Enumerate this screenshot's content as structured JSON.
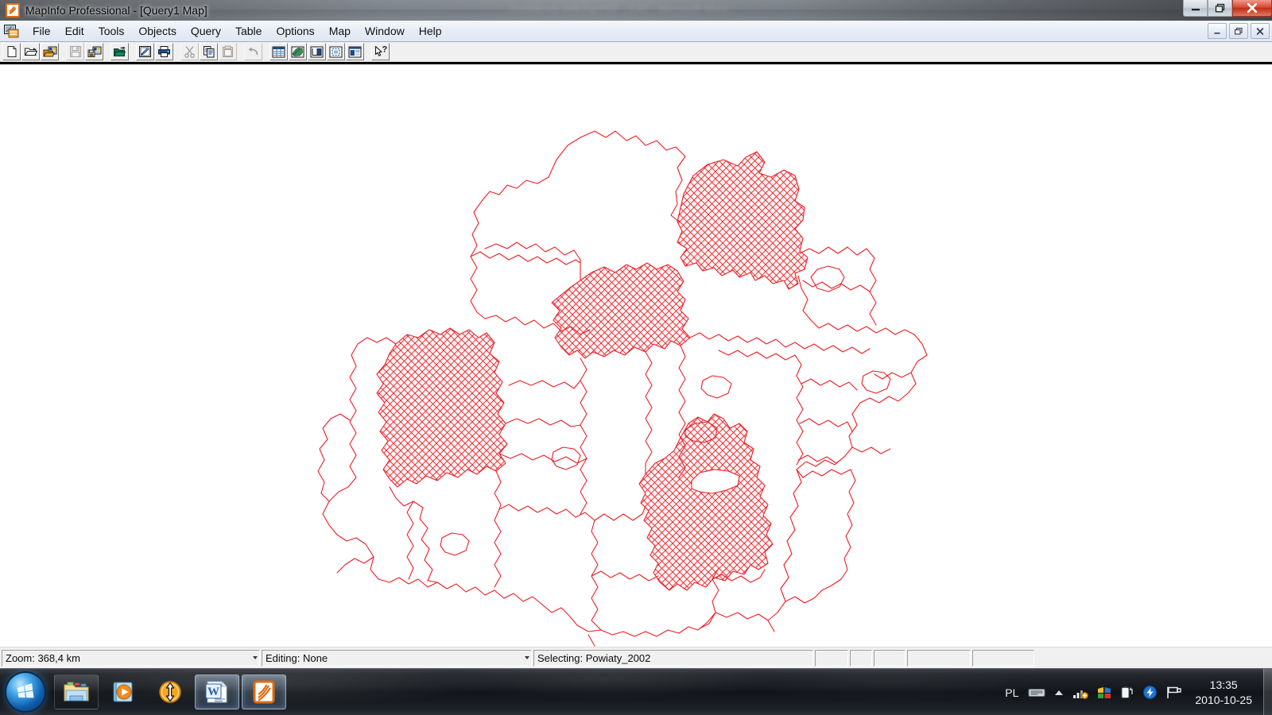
{
  "window": {
    "title": "MapInfo Professional - [Query1 Map]",
    "app_icon": "mapinfo-icon",
    "ghost_title_behind": "Dodatkowy edit.ing.PDF - CAT - Microsoft Word",
    "controls": [
      {
        "name": "minimize-button",
        "glyph": "minimize-icon"
      },
      {
        "name": "restore-button",
        "glyph": "restore-icon"
      },
      {
        "name": "close-button",
        "glyph": "close-icon"
      }
    ],
    "accent_close": "#c8341a"
  },
  "menubar": {
    "mdi_icon": "mapinfo-document-icon",
    "items": [
      {
        "label": "File"
      },
      {
        "label": "Edit"
      },
      {
        "label": "Tools"
      },
      {
        "label": "Objects"
      },
      {
        "label": "Query"
      },
      {
        "label": "Table"
      },
      {
        "label": "Options"
      },
      {
        "label": "Map"
      },
      {
        "label": "Window"
      },
      {
        "label": "Help"
      }
    ],
    "mdi_controls": [
      {
        "name": "mdi-minimize-button",
        "glyph": "_"
      },
      {
        "name": "mdi-restore-button",
        "glyph": "restore-icon"
      },
      {
        "name": "mdi-close-button",
        "glyph": "×"
      }
    ]
  },
  "toolbar": {
    "buttons": [
      {
        "name": "new-table-button",
        "icon": "new-document-icon",
        "enabled": true
      },
      {
        "name": "open-table-button",
        "icon": "open-folder-icon",
        "enabled": true
      },
      {
        "name": "open-workspace-button",
        "icon": "open-workspace-icon",
        "enabled": true
      },
      {
        "name": "save-table-button",
        "icon": "save-floppy-icon",
        "enabled": false
      },
      {
        "name": "save-workspace-button",
        "icon": "save-workspace-icon",
        "enabled": true
      },
      {
        "name": "save-window-button",
        "icon": "save-window-icon",
        "enabled": true
      },
      {
        "name": "print-preview-button",
        "icon": "print-preview-icon",
        "enabled": true
      },
      {
        "name": "print-button",
        "icon": "printer-icon",
        "enabled": true
      },
      {
        "name": "cut-button",
        "icon": "scissors-icon",
        "enabled": false
      },
      {
        "name": "copy-button",
        "icon": "copy-icon",
        "enabled": true
      },
      {
        "name": "paste-button",
        "icon": "paste-icon",
        "enabled": false
      },
      {
        "name": "undo-button",
        "icon": "undo-arrow-icon",
        "enabled": false
      },
      {
        "name": "new-browser-button",
        "icon": "browser-grid-icon",
        "enabled": true
      },
      {
        "name": "new-mapper-button",
        "icon": "map-globe-icon",
        "enabled": true
      },
      {
        "name": "new-grapher-button",
        "icon": "grapher-icon",
        "enabled": true
      },
      {
        "name": "new-layout-button",
        "icon": "layout-icon",
        "enabled": true
      },
      {
        "name": "new-redistrict-button",
        "icon": "redistrict-icon",
        "enabled": true
      },
      {
        "name": "help-pointer-button",
        "icon": "help-arrow-icon",
        "enabled": true
      }
    ]
  },
  "map": {
    "layer_name": "Powiaty_2002",
    "outline_color": "#ee1c24",
    "fill_background": "#ffffff",
    "selection_fill": "#f6d9d9",
    "selection_pattern": "diagonal-crosshatch",
    "description": "Administrative districts (powiaty) boundary map with several districts selected and shown with red diagonal cross-hatching"
  },
  "statusbar": {
    "panels": [
      {
        "name": "zoom-panel",
        "label": "Zoom: 368,4 km",
        "has_grip": true
      },
      {
        "name": "editing-panel",
        "label": "Editing: None",
        "has_grip": true
      },
      {
        "name": "selecting-panel",
        "label": "Selecting: Powiaty_2002",
        "has_grip": false
      },
      {
        "name": "status-panel-4",
        "label": "",
        "has_grip": false
      },
      {
        "name": "status-panel-5",
        "label": "",
        "has_grip": false
      },
      {
        "name": "status-panel-6",
        "label": "",
        "has_grip": false
      },
      {
        "name": "status-panel-7",
        "label": "",
        "has_grip": false
      },
      {
        "name": "status-panel-8",
        "label": "",
        "has_grip": false
      }
    ]
  },
  "taskbar": {
    "start_button": "windows-start-orb",
    "tasks": [
      {
        "name": "taskbar-item-explorer",
        "icon": "folder-explorer-icon",
        "active": false,
        "pinned": true
      },
      {
        "name": "taskbar-item-media-player",
        "icon": "media-player-icon",
        "active": false,
        "pinned": false
      },
      {
        "name": "taskbar-item-sync",
        "icon": "orange-updown-arrow-icon",
        "active": false,
        "pinned": false
      },
      {
        "name": "taskbar-item-word",
        "icon": "microsoft-word-icon",
        "active": true,
        "pinned": false
      },
      {
        "name": "taskbar-item-mapinfo",
        "icon": "mapinfo-icon",
        "active": true,
        "pinned": false
      }
    ],
    "tray": {
      "language": "PL",
      "icons": [
        {
          "name": "keyboard-layout-icon"
        },
        {
          "name": "show-hidden-icons-chevron"
        },
        {
          "name": "network-signal-icon"
        },
        {
          "name": "color-squares-app-icon"
        },
        {
          "name": "battery-icon"
        },
        {
          "name": "power-lightning-icon"
        },
        {
          "name": "action-center-flag-icon"
        }
      ],
      "time": "13:35",
      "date": "2010-10-25"
    }
  }
}
